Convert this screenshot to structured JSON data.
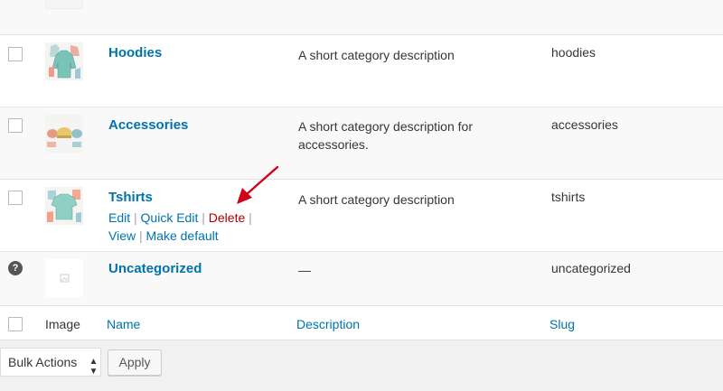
{
  "rows": [
    {
      "name": "Hoodies",
      "description": "A short category description",
      "slug": "hoodies",
      "thumb_icon": "hoodie-image"
    },
    {
      "name": "Accessories",
      "description": "A short category description for accessories.",
      "slug": "accessories",
      "thumb_icon": "accessories-image"
    },
    {
      "name": "Tshirts",
      "description": "A short category description",
      "slug": "tshirts",
      "thumb_icon": "tshirt-image",
      "actions": {
        "edit": "Edit",
        "quick_edit": "Quick Edit",
        "delete": "Delete",
        "view": "View",
        "make_default": "Make default",
        "sep": "|"
      }
    },
    {
      "name": "Uncategorized",
      "description": "—",
      "slug": "uncategorized",
      "help": "?",
      "thumb_icon": "placeholder-image"
    }
  ],
  "footer": {
    "image": "Image",
    "name": "Name",
    "description": "Description",
    "slug": "Slug"
  },
  "bulk": {
    "label": "Bulk Actions",
    "arrows": "▲▼"
  },
  "apply": "Apply",
  "colors": {
    "link": "#0073aa",
    "delete": "#aa0000",
    "annotation_arrow": "#d0021b"
  }
}
